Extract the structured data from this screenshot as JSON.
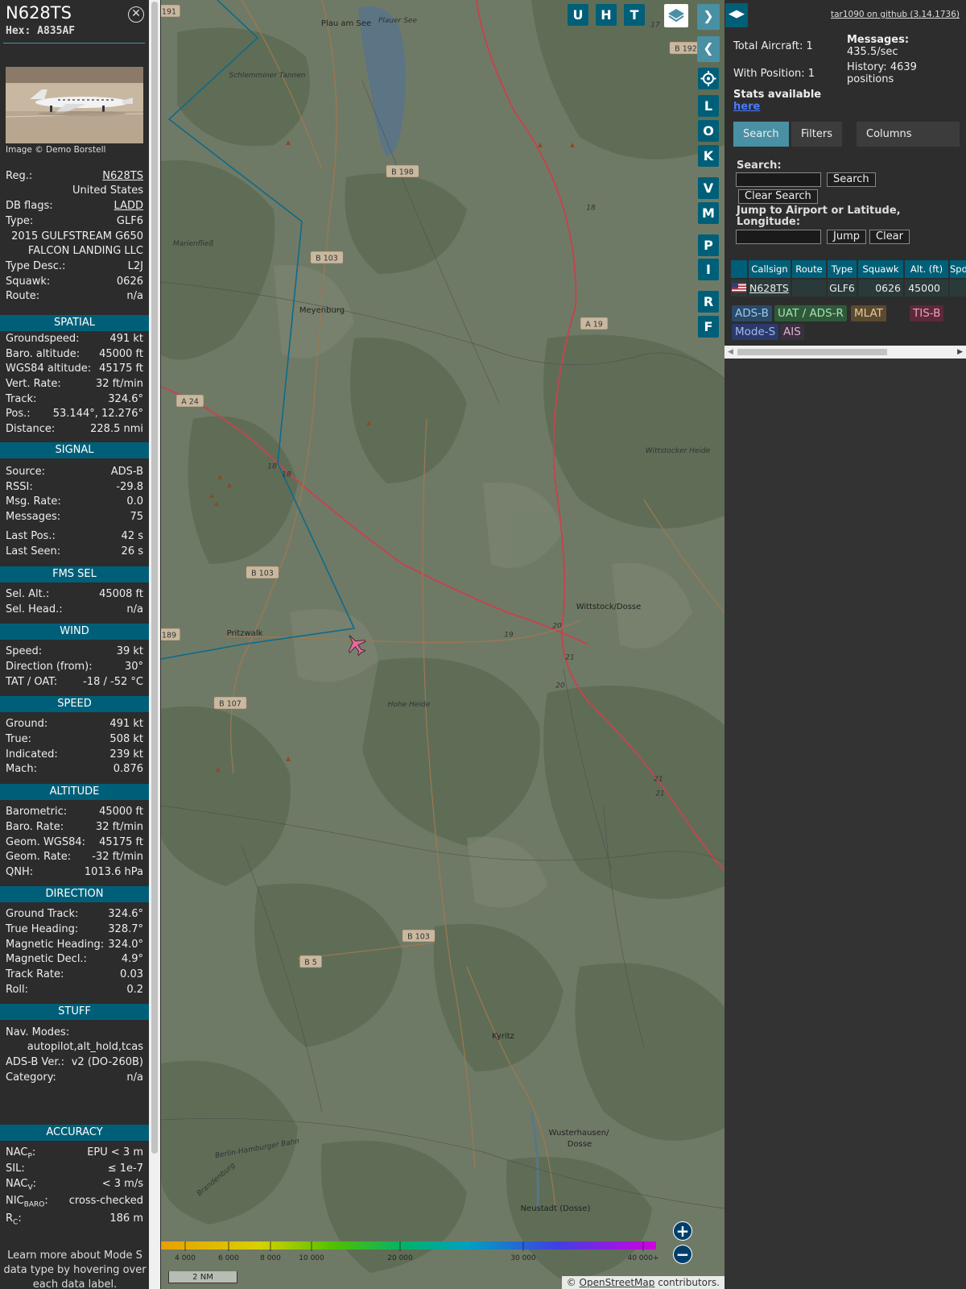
{
  "aircraft": {
    "callsign": "N628TS",
    "hex_label": "Hex: A835AF",
    "image_credit": "Image © Demo Borstell"
  },
  "details": [
    {
      "label": "Reg.:",
      "value": "N628TS"
    },
    {
      "label": "",
      "value": "United States"
    },
    {
      "label": "DB flags:",
      "value": "LADD"
    },
    {
      "label": "Type:",
      "value": "GLF6"
    },
    {
      "label": "",
      "value": "2015 GULFSTREAM G650"
    },
    {
      "label": "",
      "value": "FALCON LANDING LLC"
    },
    {
      "label": "Type Desc.:",
      "value": "L2J"
    },
    {
      "label": "Squawk:",
      "value": "0626"
    },
    {
      "label": "Route:",
      "value": "n/a"
    }
  ],
  "sections": {
    "spatial": {
      "title": "SPATIAL",
      "rows": [
        {
          "label": "Groundspeed:",
          "value": "491 kt"
        },
        {
          "label": "Baro. altitude:",
          "value": "45000 ft"
        },
        {
          "label": "WGS84 altitude:",
          "value": "45175 ft"
        },
        {
          "label": "Vert. Rate:",
          "value": "32 ft/min"
        },
        {
          "label": "Track:",
          "value": "324.6°"
        },
        {
          "label": "Pos.:",
          "value": "53.144°, 12.276°"
        },
        {
          "label": "Distance:",
          "value": "228.5 nmi"
        }
      ]
    },
    "signal": {
      "title": "SIGNAL",
      "rows": [
        {
          "label": "Source:",
          "value": "ADS-B"
        },
        {
          "label": "RSSI:",
          "value": "-29.8"
        },
        {
          "label": "Msg. Rate:",
          "value": "0.0"
        },
        {
          "label": "Messages:",
          "value": "75"
        },
        {
          "label": "Last Pos.:",
          "value": "42 s"
        },
        {
          "label": "Last Seen:",
          "value": "26 s"
        }
      ]
    },
    "fms": {
      "title": "FMS SEL",
      "rows": [
        {
          "label": "Sel. Alt.:",
          "value": "45008 ft"
        },
        {
          "label": "Sel. Head.:",
          "value": "n/a"
        }
      ]
    },
    "wind": {
      "title": "WIND",
      "rows": [
        {
          "label": "Speed:",
          "value": "39 kt"
        },
        {
          "label": "Direction (from):",
          "value": "30°"
        },
        {
          "label": "TAT / OAT:",
          "value": "-18 / -52 °C"
        }
      ]
    },
    "speed": {
      "title": "SPEED",
      "rows": [
        {
          "label": "Ground:",
          "value": "491 kt"
        },
        {
          "label": "True:",
          "value": "508 kt"
        },
        {
          "label": "Indicated:",
          "value": "239 kt"
        },
        {
          "label": "Mach:",
          "value": "0.876"
        }
      ]
    },
    "altitude": {
      "title": "ALTITUDE",
      "rows": [
        {
          "label": "Barometric:",
          "value": "45000 ft"
        },
        {
          "label": "Baro. Rate:",
          "value": "32 ft/min"
        },
        {
          "label": "Geom. WGS84:",
          "value": "45175 ft"
        },
        {
          "label": "Geom. Rate:",
          "value": "-32 ft/min"
        },
        {
          "label": "QNH:",
          "value": "1013.6 hPa"
        }
      ]
    },
    "direction": {
      "title": "DIRECTION",
      "rows": [
        {
          "label": "Ground Track:",
          "value": "324.6°"
        },
        {
          "label": "True Heading:",
          "value": "328.7°"
        },
        {
          "label": "Magnetic Heading:",
          "value": "324.0°"
        },
        {
          "label": "Magnetic Decl.:",
          "value": "4.9°"
        },
        {
          "label": "Track Rate:",
          "value": "0.03"
        },
        {
          "label": "Roll:",
          "value": "0.2"
        }
      ]
    },
    "stuff": {
      "title": "STUFF",
      "nav_label": "Nav. Modes:",
      "nav_value": "autopilot,alt_hold,tcas",
      "rows": [
        {
          "label": "ADS-B Ver.:",
          "value": "v2 (DO-260B)"
        },
        {
          "label": "Category:",
          "value": "n/a"
        }
      ]
    },
    "accuracy": {
      "title": "ACCURACY",
      "rows": [
        {
          "label": "NAC",
          "sub": "P",
          "value": "EPU < 3 m"
        },
        {
          "label": "SIL:",
          "sub": "",
          "value": "≤ 1e-7"
        },
        {
          "label": "NAC",
          "sub": "V",
          "value": "< 3 m/s"
        },
        {
          "label": "NIC",
          "sub": "BARO",
          "value": "cross-checked"
        },
        {
          "label": "R",
          "sub": "C",
          "value": "186 m"
        }
      ]
    }
  },
  "learn_more": "Learn more about Mode S data type by hovering over each data label.",
  "map": {
    "toolbar_top": [
      "U",
      "H",
      "T"
    ],
    "toolbar_side": [
      "L",
      "O",
      "K",
      "V",
      "M",
      "P",
      "I",
      "R",
      "F"
    ],
    "places": [
      "Plau am See",
      "Plauer See",
      "Schlemminer Tannen",
      "Meyenburg",
      "Marienfließ",
      "Wittstocker Heide",
      "Wittstock/Dosse",
      "Pritzwalk",
      "Hohe Heide",
      "Kyritz",
      "Wusterhausen/",
      "Dosse",
      "Neustadt (Dosse)",
      "Berlin-Hamburger Bahn",
      "Brandenburg"
    ],
    "roads": [
      "B 198",
      "B 103",
      "B 103",
      "B 103",
      "B 107",
      "B 5",
      "A 19",
      "A 24",
      "B 192",
      "191",
      "189",
      "18",
      "18",
      "19",
      "20",
      "20",
      "21",
      "21",
      "21",
      "17",
      "18"
    ],
    "legend_ticks": [
      "4 000",
      "6 000",
      "8 000",
      "10 000",
      "20 000",
      "30 000",
      "40 000+"
    ],
    "scale_label": "2 NM",
    "attribution_prefix": "© ",
    "attribution_link": "OpenStreetMap",
    "attribution_suffix": " contributors.",
    "zoom_in": "+",
    "zoom_out": "−"
  },
  "panel": {
    "github": "tar1090 on github (3.14.1736)",
    "total_aircraft": "Total Aircraft: 1",
    "with_position": "With Position: 1",
    "stats_available": "Stats available",
    "stats_link": "here",
    "messages_label": "Messages:",
    "messages_value": "435.5/sec",
    "history_label": "History: 4639",
    "history_value": "positions",
    "tabs": [
      "Search",
      "Filters",
      "Columns"
    ],
    "search_label": "Search:",
    "search_button": "Search",
    "clear_search_button": "Clear Search",
    "jump_label": "Jump to Airport or Latitude, Longitude:",
    "jump_button": "Jump",
    "clear_button": "Clear",
    "table_headers": [
      "Callsign",
      "Route",
      "Type",
      "Squawk",
      "Alt. (ft)",
      "Spd."
    ],
    "table_row": {
      "callsign": "N628TS",
      "type": "GLF6",
      "squawk": "0626",
      "alt": "45000"
    },
    "legend_chips": [
      {
        "label": "ADS-B",
        "bg": "#2a4a6a",
        "fg": "#9cc8ee"
      },
      {
        "label": "UAT / ADS-R",
        "bg": "#2e5a3a",
        "fg": "#a8e0b0"
      },
      {
        "label": "MLAT",
        "bg": "#5a4a30",
        "fg": "#e8c898"
      },
      {
        "label": "TIS-B",
        "bg": "#5a2a3a",
        "fg": "#f0a0b8"
      },
      {
        "label": "Mode-S",
        "bg": "#2a3a6a",
        "fg": "#a8b8f0"
      },
      {
        "label": "AIS",
        "bg": "#3a3040",
        "fg": "#e0b0d0"
      }
    ]
  }
}
